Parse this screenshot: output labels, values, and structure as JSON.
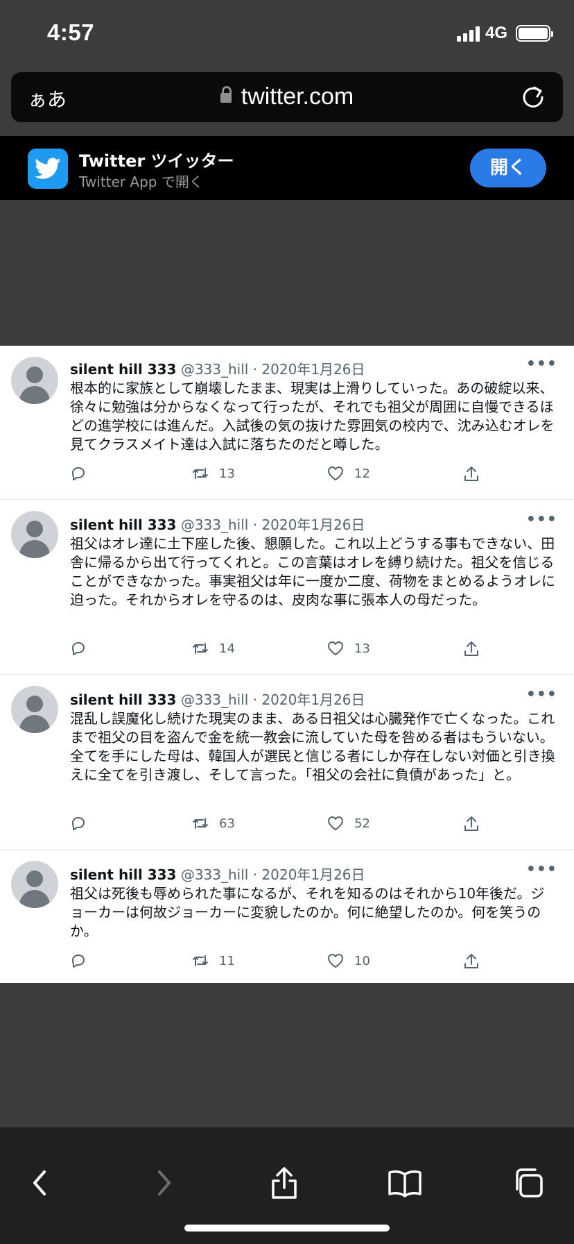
{
  "status_bar": {
    "time": "4:57",
    "network": "4G",
    "battery_level": 1.0
  },
  "browser": {
    "aa_label": "ぁあ",
    "domain": "twitter.com"
  },
  "app_banner": {
    "title": "Twitter ツイッター",
    "subtitle": "Twitter App で開く",
    "open_label": "開く"
  },
  "tweets": [
    {
      "name": "silent hill 333",
      "handle_date": "@333_hill · 2020年1月26日",
      "text": "根本的に家族として崩壊したまま、現実は上滑りしていった。あの破綻以来、徐々に勉強は分からなくなって行ったが、それでも祖父が周囲に自慢できるほどの進学校には進んだ。入試後の気の抜けた雰囲気の校内で、沈み込むオレを見てクラスメイト達は入試に落ちたのだと噂した。",
      "retweets": "13",
      "likes": "12"
    },
    {
      "name": "silent hill 333",
      "handle_date": "@333_hill · 2020年1月26日",
      "text": "祖父はオレ達に土下座した後、懇願した。これ以上どうする事もできない、田舎に帰るから出て行ってくれと。この言葉はオレを縛り続けた。祖父を信じることができなかった。事実祖父は年に一度か二度、荷物をまとめるようオレに迫った。それからオレを守るのは、皮肉な事に張本人の母だった。",
      "retweets": "14",
      "likes": "13"
    },
    {
      "name": "silent hill 333",
      "handle_date": "@333_hill · 2020年1月26日",
      "text": "混乱し誤魔化し続けた現実のまま、ある日祖父は心臓発作で亡くなった。これまで祖父の目を盗んで金を統一教会に流していた母を咎める者はもういない。全てを手にした母は、韓国人が選民と信じる者にしか存在しない対価と引き換えに全てを引き渡し、そして言った。「祖父の会社に負債があった」と。",
      "retweets": "63",
      "likes": "52"
    },
    {
      "name": "silent hill 333",
      "handle_date": "@333_hill · 2020年1月26日",
      "text": "祖父は死後も辱められた事になるが、それを知るのはそれから10年後だ。ジョーカーは何故ジョーカーに変貌したのか。何に絶望したのか。何を笑うのか。",
      "retweets": "11",
      "likes": "10"
    }
  ],
  "icons": {
    "reply": "reply-icon",
    "retweet": "retweet-icon",
    "like": "heart-icon",
    "share": "share-icon",
    "more": "more-icon"
  },
  "colors": {
    "accent": "#2a7be6",
    "twitter_blue": "#1d9bf0",
    "page_bg": "#3c3c3c",
    "toolbar_bg": "#202020"
  }
}
